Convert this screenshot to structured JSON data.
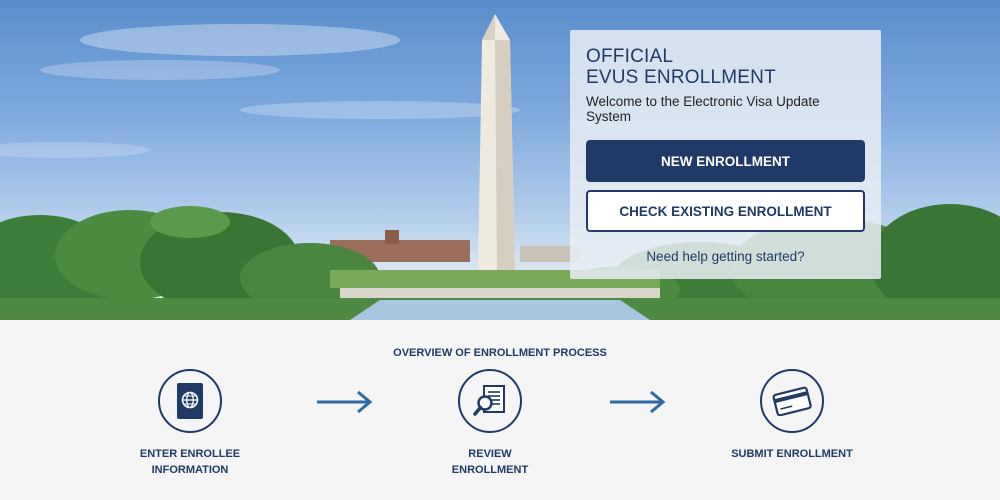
{
  "hero": {
    "image_alt": "Washington Monument and National Mall"
  },
  "card": {
    "title_line1": "OFFICIAL",
    "title_line2": "EVUS ENROLLMENT",
    "subtitle": "Welcome to the Electronic Visa Update System",
    "new_enrollment_label": "NEW ENROLLMENT",
    "check_existing_label": "CHECK EXISTING ENROLLMENT",
    "help_link": "Need help getting started?"
  },
  "overview": {
    "title": "OVERVIEW OF ENROLLMENT PROCESS",
    "steps": [
      {
        "icon": "passport-icon",
        "line1": "ENTER ENROLLEE",
        "line2": "INFORMATION"
      },
      {
        "icon": "document-search-icon",
        "line1": "REVIEW",
        "line2": "ENROLLMENT"
      },
      {
        "icon": "credit-card-icon",
        "line1": "SUBMIT ENROLLMENT",
        "line2": ""
      }
    ]
  },
  "colors": {
    "primary": "#1f3a66",
    "arrow": "#2e6aa3",
    "background": "#f5f5f5"
  }
}
